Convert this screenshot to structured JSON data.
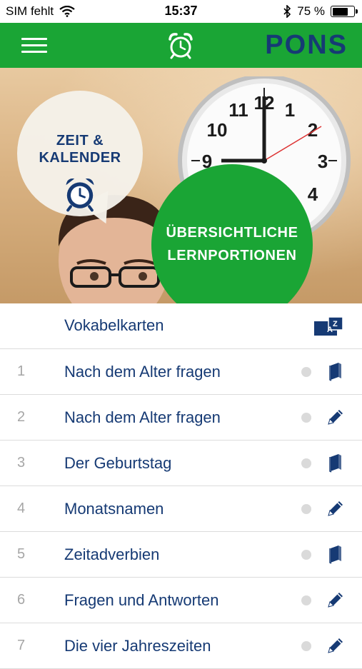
{
  "status_bar": {
    "carrier": "SIM fehlt",
    "time": "15:37",
    "battery": "75 %",
    "battery_level": 0.75
  },
  "nav": {
    "brand": "PONS",
    "icons": [
      "menu-icon",
      "alarm-clock-icon"
    ]
  },
  "hero": {
    "badge_title_line1": "ZEIT &",
    "badge_title_line2": "KALENDER",
    "promo_line1": "ÜBERSICHTLICHE",
    "promo_line2": "LERNPORTIONEN",
    "clock_numbers": [
      "12",
      "2",
      "3",
      "4",
      "9",
      "10",
      "11",
      "1"
    ]
  },
  "list": {
    "header_label": "Vokabelkarten",
    "header_icon_text": "A Z",
    "items": [
      {
        "number": "1",
        "title": "Nach dem Alter fragen",
        "icon": "book-icon"
      },
      {
        "number": "2",
        "title": "Nach dem Alter fragen",
        "icon": "pencil-icon"
      },
      {
        "number": "3",
        "title": "Der Geburtstag",
        "icon": "book-icon"
      },
      {
        "number": "4",
        "title": "Monatsnamen",
        "icon": "pencil-icon"
      },
      {
        "number": "5",
        "title": "Zeitadverbien",
        "icon": "book-icon"
      },
      {
        "number": "6",
        "title": "Fragen und Antworten",
        "icon": "pencil-icon"
      },
      {
        "number": "7",
        "title": "Die vier Jahreszeiten",
        "icon": "pencil-icon"
      }
    ]
  },
  "colors": {
    "brand_green": "#1aa535",
    "navy": "#163a74",
    "divider": "#dcdcdc",
    "dot": "#dadada"
  }
}
